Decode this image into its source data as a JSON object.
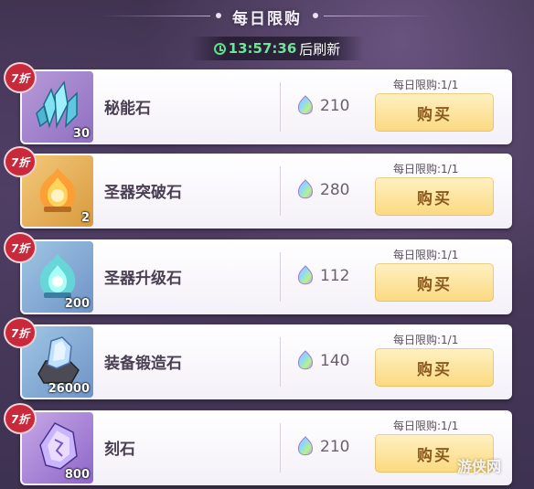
{
  "header": {
    "title": "每日限购"
  },
  "timer": {
    "time": "13:57:36",
    "suffix": "后刷新"
  },
  "items": [
    {
      "badge": "7折",
      "name": "秘能石",
      "qty": "30",
      "price": "210",
      "limit": "每日限购:1/1",
      "buy_label": "购买",
      "theme": "blue",
      "icon": "crystal-cluster-icon"
    },
    {
      "badge": "7折",
      "name": "圣器突破石",
      "qty": "2",
      "price": "280",
      "limit": "每日限购:1/1",
      "buy_label": "购买",
      "theme": "orange",
      "icon": "flame-orb-icon"
    },
    {
      "badge": "7折",
      "name": "圣器升级石",
      "qty": "200",
      "price": "112",
      "limit": "每日限购:1/1",
      "buy_label": "购买",
      "theme": "teal",
      "icon": "aqua-orb-icon"
    },
    {
      "badge": "7折",
      "name": "装备锻造石",
      "qty": "26000",
      "price": "140",
      "limit": "每日限购:1/1",
      "buy_label": "购买",
      "theme": "teal",
      "icon": "forging-stone-icon"
    },
    {
      "badge": "7折",
      "name": "刻石",
      "qty": "800",
      "price": "210",
      "limit": "每日限购:1/1",
      "buy_label": "购买",
      "theme": "purple",
      "icon": "rune-crystal-icon"
    }
  ],
  "currency_icon": "rainbow-gem-icon",
  "colors": {
    "badge": "#c8293b",
    "timer_green": "#6fe39a",
    "buy_button": "#fbd980",
    "buy_text": "#8a5a1e"
  },
  "watermark": "游侠网"
}
